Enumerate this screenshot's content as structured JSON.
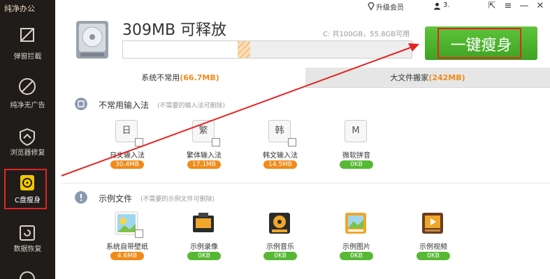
{
  "app": {
    "title": "纯净办公"
  },
  "window": {
    "vip_label": "升级会员",
    "user_label": "3.",
    "btn_pin": "⇱",
    "btn_menu": "≡",
    "btn_min": "—",
    "btn_close": "✕"
  },
  "sidebar": {
    "items": [
      {
        "label": "弹窗拦截"
      },
      {
        "label": "纯净无广告"
      },
      {
        "label": "浏览器修复"
      },
      {
        "label": "C盘瘦身"
      },
      {
        "label": "数据恢复"
      }
    ]
  },
  "header": {
    "total_size": "309MB 可释放",
    "disk_info": "C: 共100GB，55.8GB可用",
    "disk_used_fraction": 0.397,
    "release_fraction": 0.044,
    "slim_button": "一键瘦身"
  },
  "tabs": [
    {
      "name": "系统不常用",
      "size": "(66.7MB)"
    },
    {
      "name": "大文件搬家",
      "size": "(242MB)"
    }
  ],
  "sections": [
    {
      "title": "不常用输入法",
      "hint": "(不需要的输入法可删除)",
      "items": [
        {
          "glyph": "日",
          "label": "日文输入法",
          "size": "30.4MB",
          "status": "orange"
        },
        {
          "glyph": "繁",
          "label": "繁体输入法",
          "size": "17.1MB",
          "status": "orange"
        },
        {
          "glyph": "韩",
          "label": "韩文输入法",
          "size": "14.5MB",
          "status": "orange"
        },
        {
          "glyph": "M",
          "label": "微软拼音",
          "size": "0KB",
          "status": "green"
        }
      ]
    },
    {
      "title": "示例文件",
      "hint": "(不需要的示例文件可删除)",
      "items": [
        {
          "label": "系统自带壁纸",
          "size": "4.6MB",
          "status": "orange"
        },
        {
          "label": "示例录像",
          "size": "0KB",
          "status": "green"
        },
        {
          "label": "示例音乐",
          "size": "0KB",
          "status": "green"
        },
        {
          "label": "示例图片",
          "size": "0KB",
          "status": "green"
        },
        {
          "label": "示例视频",
          "size": "0KB",
          "status": "green"
        }
      ]
    }
  ],
  "colors": {
    "accent_orange": "#f08b1a",
    "accent_green": "#57b834",
    "highlight_red": "#e52424",
    "sidebar_bg": "#1f1c1a"
  }
}
